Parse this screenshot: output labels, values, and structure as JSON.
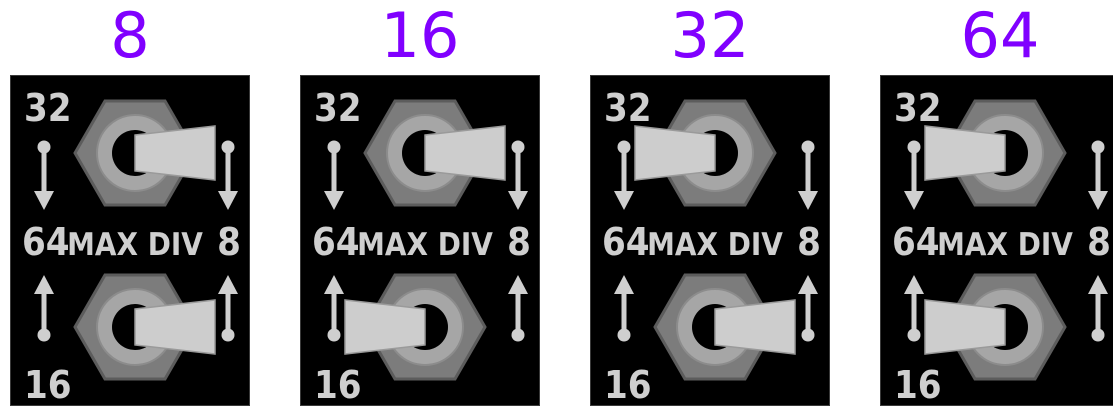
{
  "colors": {
    "heading": "#8000ff",
    "panel_bg": "#000000",
    "panel_edge": "#3a3a3a",
    "ink": "#cfcfcf",
    "nut_outer": "#7c7c7c",
    "nut_inner": "#a6a6a6",
    "lever": "#cdcdcd"
  },
  "panels": [
    {
      "heading": "8",
      "label_top": "32",
      "label_mid_left": "64",
      "label_mid_center": "MAX DIV",
      "label_mid_right": "8",
      "label_bottom": "16",
      "top_switch": "right",
      "bottom_switch": "right"
    },
    {
      "heading": "16",
      "label_top": "32",
      "label_mid_left": "64",
      "label_mid_center": "MAX DIV",
      "label_mid_right": "8",
      "label_bottom": "16",
      "top_switch": "right",
      "bottom_switch": "left"
    },
    {
      "heading": "32",
      "label_top": "32",
      "label_mid_left": "64",
      "label_mid_center": "MAX DIV",
      "label_mid_right": "8",
      "label_bottom": "16",
      "top_switch": "left",
      "bottom_switch": "right"
    },
    {
      "heading": "64",
      "label_top": "32",
      "label_mid_left": "64",
      "label_mid_center": "MAX DIV",
      "label_mid_right": "8",
      "label_bottom": "16",
      "top_switch": "left",
      "bottom_switch": "left"
    }
  ]
}
